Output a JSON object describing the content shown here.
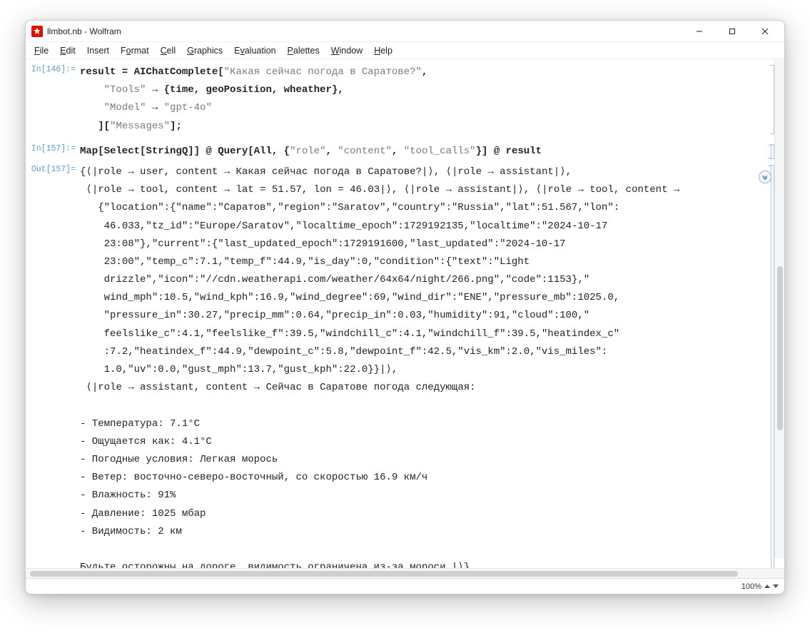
{
  "window": {
    "title": "llmbot.nb - Wolfram"
  },
  "menu": {
    "file": "File",
    "edit": "Edit",
    "insert": "Insert",
    "format": "Format",
    "cell": "Cell",
    "graphics": "Graphics",
    "evaluation": "Evaluation",
    "palettes": "Palettes",
    "window": "Window",
    "help": "Help"
  },
  "in146": {
    "label": "In[146]:=",
    "line1a": "result = AIChatComplete[",
    "line1b": "\"Какая сейчас погода в Саратове?\"",
    "line1c": ",",
    "line2a": "\"Tools\"",
    "line2b": " → {time, geoPosition, wheather},",
    "line3a": "\"Model\"",
    "line3b": " → ",
    "line3c": "\"gpt-4o\"",
    "line4a": "][",
    "line4b": "\"Messages\"",
    "line4c": "];"
  },
  "in157": {
    "label": "In[157]:=",
    "code_a": "Map[Select[StringQ]] @ Query[All, {",
    "code_b": "\"role\"",
    "code_c": ", ",
    "code_d": "\"content\"",
    "code_e": ", ",
    "code_f": "\"tool_calls\"",
    "code_g": "}] @ result"
  },
  "out157": {
    "label": "Out[157]=",
    "text": "{⟨|role → user, content → Какая сейчас погода в Саратове?|⟩, ⟨|role → assistant|⟩,\n ⟨|role → tool, content → lat = 51.57, lon = 46.03|⟩, ⟨|role → assistant|⟩, ⟨|role → tool, content →\n   {\"location\":{\"name\":\"Саратов\",\"region\":\"Saratov\",\"country\":\"Russia\",\"lat\":51.567,\"lon\":\n    46.033,\"tz_id\":\"Europe/Saratov\",\"localtime_epoch\":1729192135,\"localtime\":\"2024-10-17\n    23:08\"},\"current\":{\"last_updated_epoch\":1729191600,\"last_updated\":\"2024-10-17\n    23:00\",\"temp_c\":7.1,\"temp_f\":44.9,\"is_day\":0,\"condition\":{\"text\":\"Light\n    drizzle\",\"icon\":\"//cdn.weatherapi.com/weather/64x64/night/266.png\",\"code\":1153},\"\n    wind_mph\":10.5,\"wind_kph\":16.9,\"wind_degree\":69,\"wind_dir\":\"ENE\",\"pressure_mb\":1025.0,\n    \"pressure_in\":30.27,\"precip_mm\":0.64,\"precip_in\":0.03,\"humidity\":91,\"cloud\":100,\"\n    feelslike_c\":4.1,\"feelslike_f\":39.5,\"windchill_c\":4.1,\"windchill_f\":39.5,\"heatindex_c\"\n    :7.2,\"heatindex_f\":44.9,\"dewpoint_c\":5.8,\"dewpoint_f\":42.5,\"vis_km\":2.0,\"vis_miles\":\n    1.0,\"uv\":0.0,\"gust_mph\":13.7,\"gust_kph\":22.0}}|⟩,\n ⟨|role → assistant, content → Сейчас в Саратове погода следующая:\n\n- Температура: 7.1°C\n- Ощущается как: 4.1°C\n- Погодные условия: Легкая морось\n- Ветер: восточно-северо-восточный, со скоростью 16.9 км/ч\n- Влажность: 91%\n- Давление: 1025 мбар\n- Видимость: 2 км\n\nБудьте осторожны на дороге, видимость ограничена из-за мороси.|⟩}"
  },
  "status": {
    "zoom": "100%"
  }
}
